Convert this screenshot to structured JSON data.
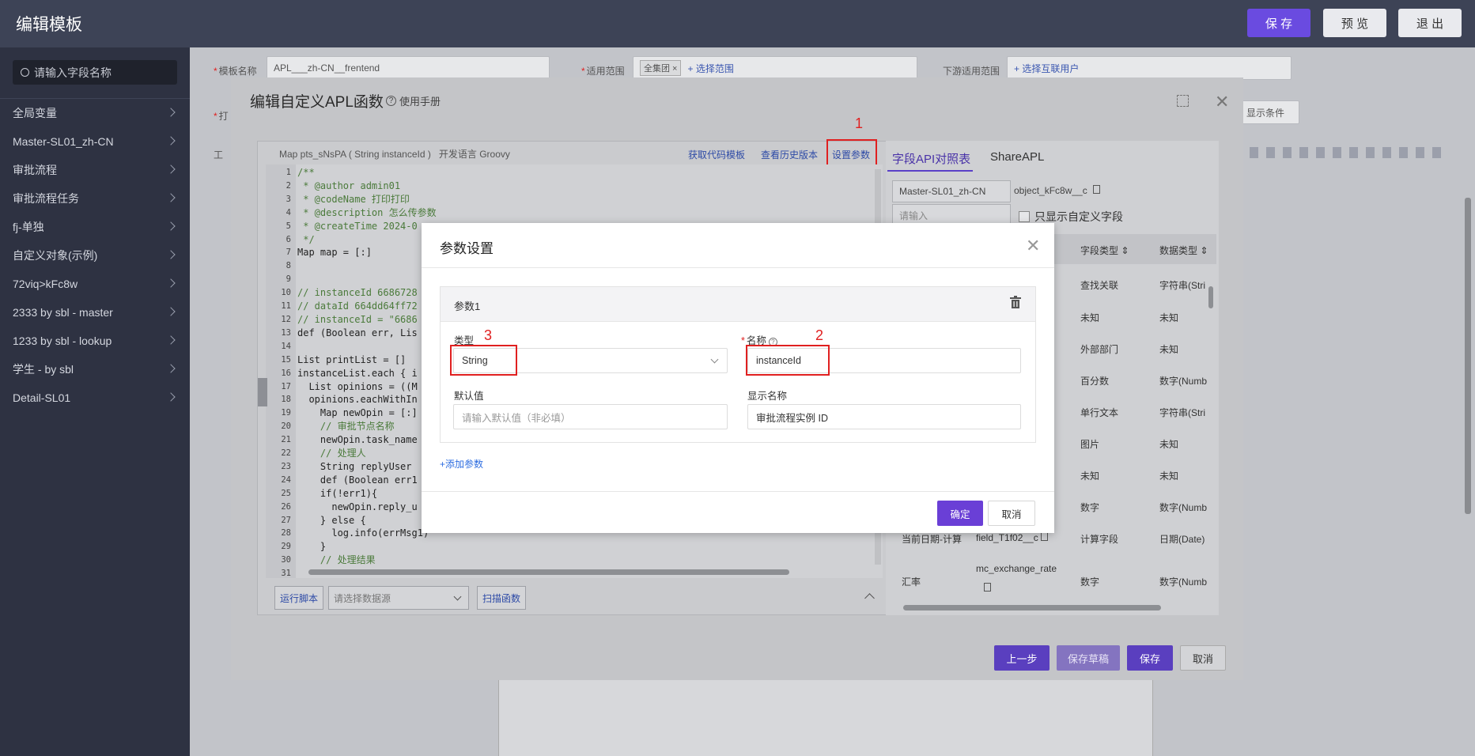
{
  "topbar": {
    "title": "编辑模板",
    "save": "保 存",
    "preview": "预 览",
    "exit": "退 出"
  },
  "sidebar": {
    "search_placeholder": "请输入字段名称",
    "items": [
      "全局变量",
      "Master-SL01_zh-CN",
      "审批流程",
      "审批流程任务",
      "fj-单独",
      "自定义对象(示例)",
      "72viq>kFc8w",
      "2333 by sbl - master",
      "1233 by sbl - lookup",
      "学生 - by sbl",
      "Detail-SL01"
    ]
  },
  "background_form": {
    "template_name_label": "模板名称",
    "template_name_value": "APL___zh-CN__frentend",
    "scope_label": "适用范围",
    "scope_tag": "全集团",
    "scope_link": "+ 选择范围",
    "downstream_label": "下游适用范围",
    "downstream_link": "+ 选择互联用户",
    "row2_label": "打",
    "show_condition": "显示条件",
    "tools_label": "工"
  },
  "apl_dialog": {
    "title": "编辑自定义APL函数",
    "manual": "使用手册",
    "signature": "Map pts_sNsPA ( String instanceId )",
    "language": "开发语言 Groovy",
    "get_template": "获取代码模板",
    "history": "查看历史版本",
    "set_params": "设置参数",
    "line_numbers": [
      "1",
      "2",
      "3",
      "4",
      "5",
      "6",
      "7",
      "8",
      "9",
      "10",
      "11",
      "12",
      "13",
      "14",
      "15",
      "16",
      "17",
      "18",
      "19",
      "20",
      "21",
      "22",
      "23",
      "24",
      "25",
      "26",
      "27",
      "28",
      "29",
      "30",
      "31"
    ],
    "code_lines": [
      "/**",
      " * @author admin01",
      " * @codeName 打印打印",
      " * @description 怎么传参数",
      " * @createTime 2024-0",
      " */",
      "Map map = [:]",
      "",
      "",
      "// instanceId 6686728",
      "// dataId 664dd64ff72",
      "// instanceId = \"6686",
      "def (Boolean err, Lis",
      "",
      "List printList = []",
      "instanceList.each { i",
      "  List opinions = ((M",
      "  opinions.eachWithIn",
      "    Map newOpin = [:]",
      "    // 审批节点名称",
      "    newOpin.task_name",
      "    // 处理人",
      "    String replyUser",
      "    def (Boolean err1",
      "    if(!err1){",
      "      newOpin.reply_u",
      "    } else {",
      "      log.info(errMsg1)",
      "    }",
      "    // 处理结果",
      ""
    ],
    "run_script": "运行脚本",
    "datasource_placeholder": "请选择数据源",
    "scan_functions": "扫描函数",
    "tabs": [
      "字段API对照表",
      "ShareAPL"
    ],
    "object_select": "Master-SL01_zh-CN",
    "object_api": "object_kFc8w__c",
    "search_placeholder": "请输入",
    "only_custom": "只显示自定义字段",
    "columns": [
      "字段类型",
      "数据类型"
    ],
    "rows": [
      {
        "ftype": "查找关联",
        "dtype": "字符串(Stri"
      },
      {
        "ftype": "未知",
        "dtype": "未知"
      },
      {
        "ftype": "外部部门",
        "dtype": "未知"
      },
      {
        "ftype": "百分数",
        "dtype": "数字(Numb"
      },
      {
        "ftype": "单行文本",
        "dtype": "字符串(Stri"
      },
      {
        "ftype": "图片",
        "dtype": "未知"
      },
      {
        "ftype": "未知",
        "dtype": "未知"
      },
      {
        "ftype": "数字",
        "dtype": "数字(Numb"
      },
      {
        "name": "当前日期-计算",
        "api": "field_T1f02__c",
        "ftype": "计算字段",
        "dtype": "日期(Date)"
      },
      {
        "name": "汇率",
        "api": "mc_exchange_rate",
        "ftype": "数字",
        "dtype": "数字(Numb"
      }
    ],
    "prev": "上一步",
    "save_draft": "保存草稿",
    "save": "保存",
    "cancel": "取消"
  },
  "param_modal": {
    "title": "参数设置",
    "card_title": "参数1",
    "type_label": "类型",
    "type_value": "String",
    "name_label": "名称",
    "name_value": "instanceId",
    "default_label": "默认值",
    "default_placeholder": "请输入默认值（非必填）",
    "display_label": "显示名称",
    "display_value": "审批流程实例 ID",
    "add_param": "+添加参数",
    "ok": "确定",
    "cancel": "取消"
  },
  "annotations": {
    "n1": "1",
    "n2": "2",
    "n3": "3"
  },
  "colors": {
    "accent": "#6a4be0",
    "annotation": "#e02020",
    "link": "#2d4aa6"
  }
}
